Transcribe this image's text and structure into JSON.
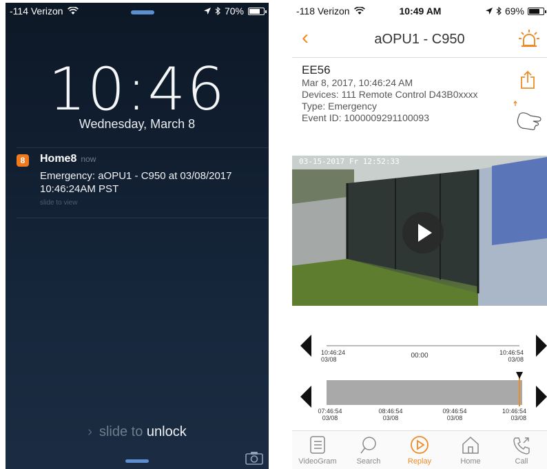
{
  "lock_screen": {
    "status": {
      "carrier": "-114 Verizon",
      "battery": "70%",
      "battery_level": 0.7
    },
    "time": "10:46",
    "date": "Wednesday, March 8",
    "notification": {
      "app_name": "Home8",
      "time": "now",
      "body": "Emergency: aOPU1 - C950 at 03/08/2017 10:46:24AM PST",
      "hint": "slide to view"
    },
    "unlock_prefix": "slide to ",
    "unlock_emphasis": "unlock"
  },
  "app_screen": {
    "status": {
      "carrier": "-118 Verizon",
      "time": "10:49 AM",
      "battery": "69%",
      "battery_level": 0.69
    },
    "nav": {
      "back_icon": "chevron-left-icon",
      "title": "aOPU1 - C950",
      "alarm_icon": "siren-icon"
    },
    "event": {
      "id": "EE56",
      "datetime": "Mar 8, 2017, 10:46:24 AM",
      "devices": "Devices: 111 Remote Control D43B0xxxx",
      "type": "Type: Emergency",
      "event_id": "Event ID: 1000009291100093"
    },
    "video": {
      "timestamp": "03-15-2017 Fr 12:52:33"
    },
    "timeline_top": {
      "start_time": "10:46:24",
      "start_date": "03/08",
      "center": "00:00",
      "end_time": "10:46:54",
      "end_date": "03/08"
    },
    "timeline_bottom": {
      "ticks": [
        {
          "time": "07:46:54",
          "date": "03/08"
        },
        {
          "time": "08:46:54",
          "date": "03/08"
        },
        {
          "time": "09:46:54",
          "date": "03/08"
        },
        {
          "time": "10:46:54",
          "date": "03/08"
        }
      ]
    },
    "tabs": [
      {
        "label": "VideoGram",
        "icon": "list-icon",
        "active": false
      },
      {
        "label": "Search",
        "icon": "search-icon",
        "active": false
      },
      {
        "label": "Replay",
        "icon": "play-circle-icon",
        "active": true
      },
      {
        "label": "Home",
        "icon": "home-icon",
        "active": false
      },
      {
        "label": "Call",
        "icon": "phone-icon",
        "active": false
      }
    ],
    "accent_color": "#f08a24"
  }
}
